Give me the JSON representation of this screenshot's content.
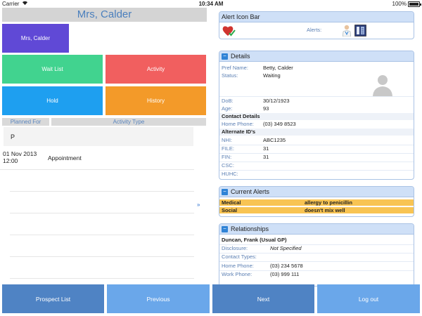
{
  "status_bar": {
    "carrier": "Carrier",
    "time": "10:34 AM",
    "battery": "100%"
  },
  "patient": {
    "title": "Mrs, Calder",
    "tile_label": "Mrs, Calder"
  },
  "tiles": {
    "wait_list": "Wait List",
    "activity": "Activity",
    "hold": "Hold",
    "history": "History"
  },
  "list": {
    "headers": {
      "planned_for": "Planned For",
      "activity_type": "Activity Type"
    },
    "group_label": "P",
    "rows": [
      {
        "date": "01 Nov 2013",
        "time": "12:00",
        "type": "Appointment"
      }
    ],
    "more_link": "»"
  },
  "alert_icon_bar": {
    "title": "Alert Icon Bar",
    "alerts_label": "Alerts:"
  },
  "details": {
    "title": "Details",
    "pref_name": {
      "label": "Pref Name:",
      "value": "Betty, Calder"
    },
    "status": {
      "label": "Status:",
      "value": "Waiting"
    },
    "dob": {
      "label": "DoB:",
      "value": "30/12/1923"
    },
    "age": {
      "label": "Age:",
      "value": "93"
    },
    "contact_section": "Contact Details",
    "home_phone": {
      "label": "Home Phone:",
      "value": "(03) 349 8523"
    },
    "alt_section": "Alternate ID's",
    "nhi": {
      "label": "NHI:",
      "value": "ABC1235"
    },
    "file": {
      "label": "FILE:",
      "value": "31"
    },
    "fin": {
      "label": "FIN:",
      "value": "31"
    },
    "csc": {
      "label": "CSC:",
      "value": ""
    },
    "huhc": {
      "label": "HUHC:",
      "value": ""
    }
  },
  "current_alerts": {
    "title": "Current Alerts",
    "items": [
      {
        "type": "Medical",
        "description": "allergy to penicillin"
      },
      {
        "type": "Social",
        "description": "doesn't mix well"
      }
    ]
  },
  "relationships": {
    "title": "Relationships",
    "name": "Duncan, Frank (Usual GP)",
    "disclosure": {
      "label": "Disclosure:",
      "value": "Not Specified"
    },
    "contact_types": {
      "label": "Contact Types:",
      "value": ""
    },
    "home_phone": {
      "label": "Home Phone:",
      "value": "(03) 234 5678"
    },
    "work_phone": {
      "label": "Work Phone:",
      "value": "(03) 999 111"
    }
  },
  "bottom_bar": {
    "prospect_list": "Prospect List",
    "previous": "Previous",
    "next": "Next",
    "log_out": "Log out"
  },
  "colors": {
    "patient_tile": "#6049d6",
    "wait_list": "#41d38f",
    "activity": "#f15f5f",
    "hold": "#1e9ff0",
    "history": "#f39a29",
    "alert_row": "#f8c453",
    "panel_header": "#cfe0f7",
    "bottom_dark": "#4f83c4",
    "bottom_light": "#6aa7ea"
  }
}
